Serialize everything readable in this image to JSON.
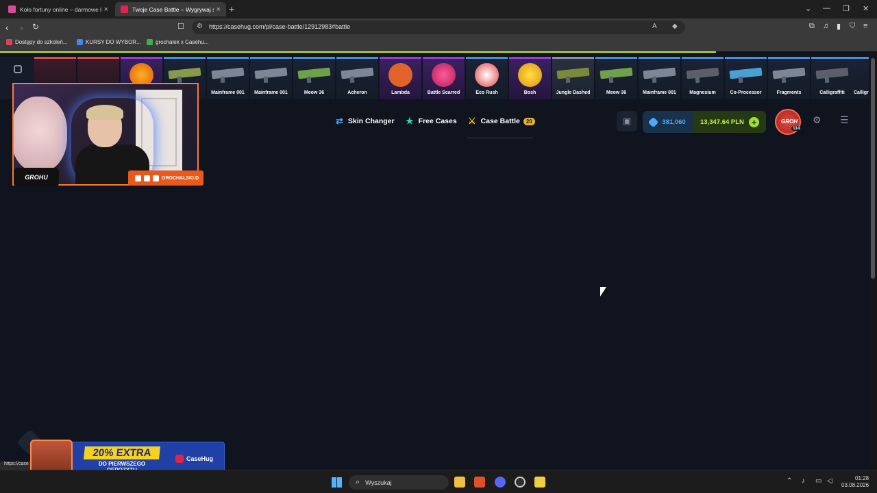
{
  "browser": {
    "tabs": [
      {
        "title": "Koło fortuny online – darmowe koło",
        "active": false
      },
      {
        "title": "Twoje Case Battle – Wygrywaj sk",
        "active": true
      }
    ],
    "url": "https://casehug.com/pl/case-battle/12912983#battle",
    "bookmarks": [
      "Dostępy do szkoleń...",
      "KURSY DO WYBOR...",
      "grochalek x Casehu..."
    ]
  },
  "drops_strip": {
    "items": [
      {
        "label": "Mainframe 001",
        "rarity": "blue"
      },
      {
        "label": "Mainframe 001",
        "rarity": "blue"
      },
      {
        "label": "Meow 36",
        "rarity": "blue"
      },
      {
        "label": "Acheron",
        "rarity": "blue"
      },
      {
        "label": "Lambda",
        "rarity": "purple"
      },
      {
        "label": "Battle Scarred",
        "rarity": "purple"
      },
      {
        "label": "Eco Rush",
        "rarity": "blue"
      },
      {
        "label": "Bosh",
        "rarity": "purple"
      },
      {
        "label": "Jungle Dashed",
        "rarity": "gray"
      },
      {
        "label": "Meow 36",
        "rarity": "blue"
      },
      {
        "label": "Mainframe 001",
        "rarity": "blue"
      },
      {
        "label": "Magnesium",
        "rarity": "blue"
      },
      {
        "label": "Co-Processor",
        "rarity": "blue"
      },
      {
        "label": "Fragments",
        "rarity": "blue"
      },
      {
        "label": "Calligraffiti",
        "rarity": "blue"
      },
      {
        "label": "Calligr",
        "rarity": "blue"
      }
    ]
  },
  "header": {
    "nav": [
      {
        "label": "Skin Changer",
        "icon": "swap-arrows-icon"
      },
      {
        "label": "Free Cases",
        "icon": "star-icon"
      },
      {
        "label": "Case Battle",
        "icon": "crossed-swords-icon",
        "badge": "20"
      }
    ],
    "coins": "381,060",
    "balance": "13,347.64 PLN",
    "avatar_label": "GROH",
    "level": "114"
  },
  "stream_overlay": {
    "social_handle": "GROCHALSKI.D",
    "logo_text": "GROHU"
  },
  "promo": {
    "headline": "20% EXTRA",
    "line1": "DO PIERWSZEGO",
    "line2": "DEPOZYTU",
    "brand": "CaseHug"
  },
  "status_url": "https://case",
  "taskbar": {
    "search_placeholder": "Wyszukaj",
    "time": "01:28",
    "date": "03.08.2026"
  }
}
